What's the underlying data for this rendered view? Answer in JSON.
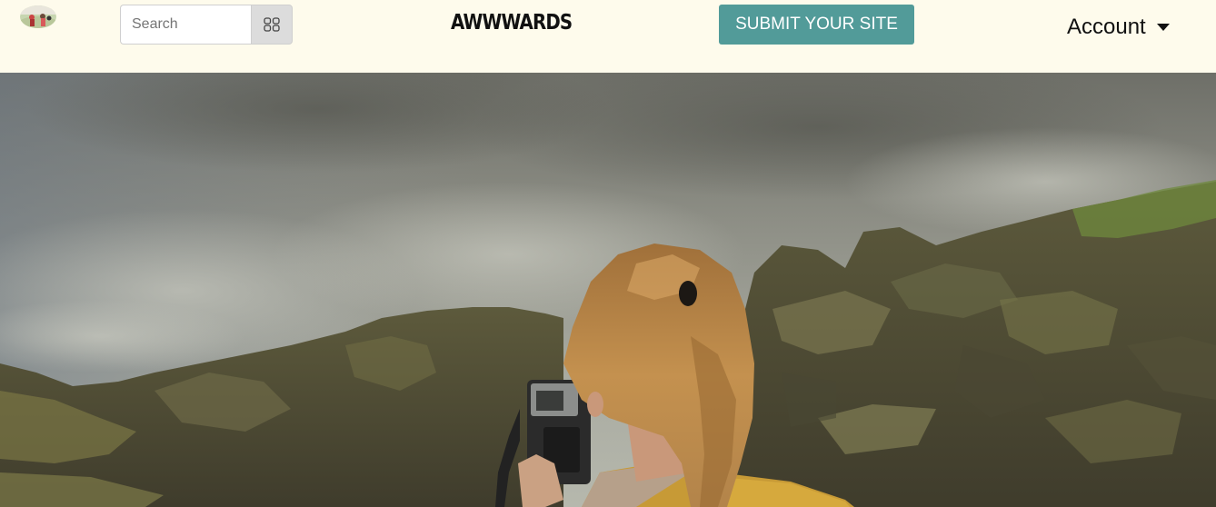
{
  "navbar": {
    "logo_icon": "avatar-thumbnail",
    "search": {
      "placeholder": "Search",
      "value": "",
      "button_icon": "grid-icon"
    },
    "brand": "AWWWARDS",
    "submit_label": "SUBMIT YOUR SITE",
    "account_label": "Account",
    "account_icon": "caret-down-icon"
  },
  "hero": {
    "image": "photo-woman-with-camera-on-rocky-hillside"
  },
  "colors": {
    "navbar_bg": "#fefbec",
    "submit_bg": "#529b99",
    "submit_text": "#ffffff",
    "search_button_bg": "#dcdcdc"
  }
}
